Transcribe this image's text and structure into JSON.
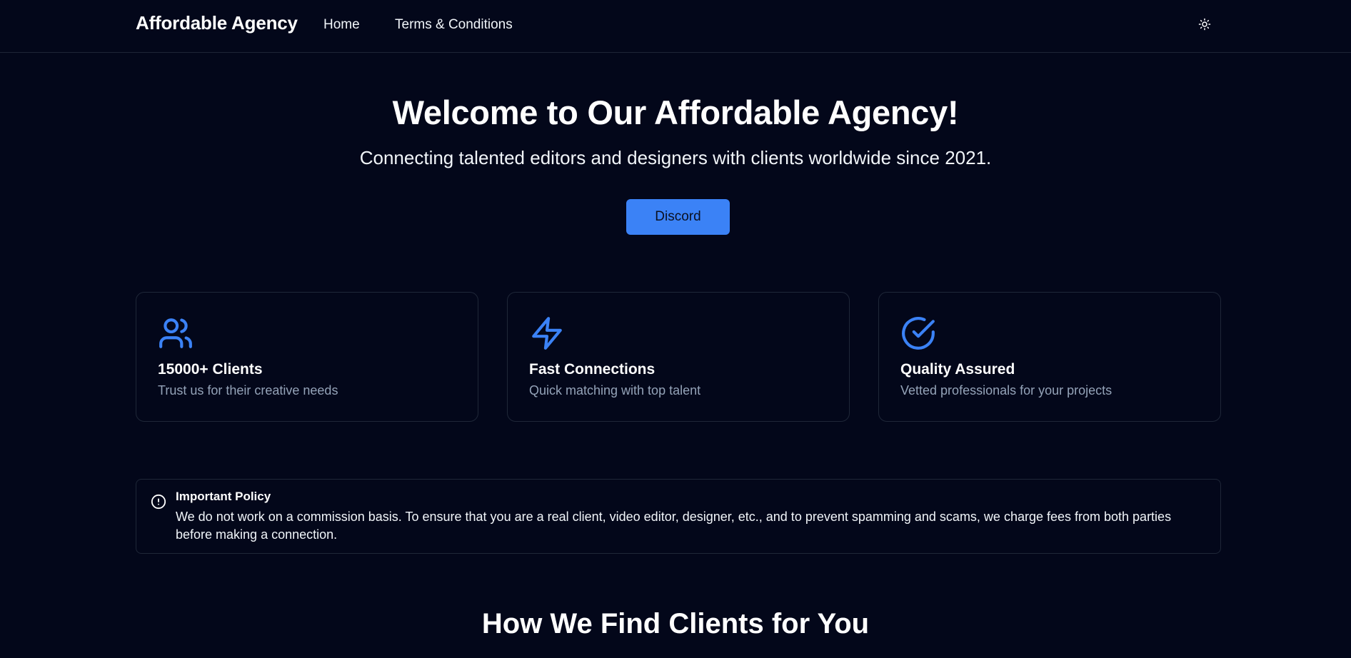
{
  "nav": {
    "brand": "Affordable Agency",
    "links": [
      {
        "label": "Home"
      },
      {
        "label": "Terms & Conditions"
      }
    ],
    "theme_icon": "sun-icon"
  },
  "hero": {
    "title": "Welcome to Our Affordable Agency!",
    "subtitle": "Connecting talented editors and designers with clients worldwide since 2021.",
    "button_label": "Discord"
  },
  "features": [
    {
      "icon": "users-icon",
      "title": "15000+ Clients",
      "description": "Trust us for their creative needs"
    },
    {
      "icon": "lightning-icon",
      "title": "Fast Connections",
      "description": "Quick matching with top talent"
    },
    {
      "icon": "check-circle-icon",
      "title": "Quality Assured",
      "description": "Vetted professionals for your projects"
    }
  ],
  "policy": {
    "icon": "alert-circle-icon",
    "title": "Important Policy",
    "text": "We do not work on a commission basis. To ensure that you are a real client, video editor, designer, etc., and to prevent spamming and scams, we charge fees from both parties before making a connection."
  },
  "section": {
    "title": "How We Find Clients for You"
  },
  "colors": {
    "background": "#03071a",
    "accent": "#3b82f6",
    "muted_text": "#94a3b8",
    "border": "#1f2738"
  }
}
